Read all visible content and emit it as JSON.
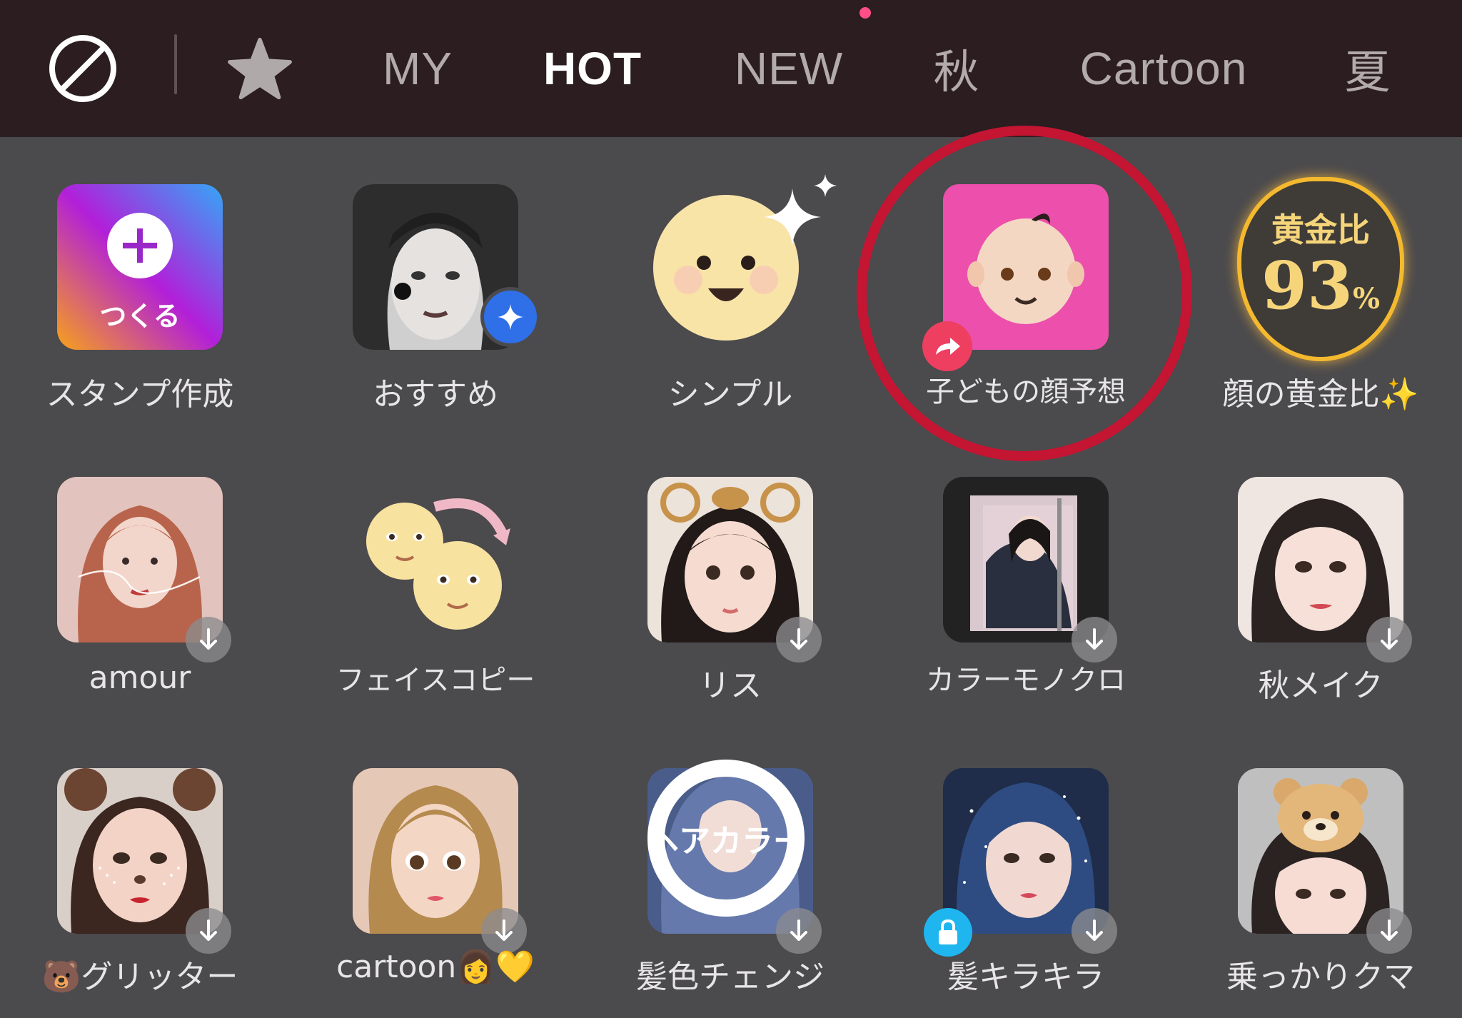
{
  "tabs": [
    {
      "label": "MY",
      "active": false
    },
    {
      "label": "HOT",
      "active": true
    },
    {
      "label": "NEW",
      "active": false
    },
    {
      "label": "秋",
      "active": false
    },
    {
      "label": "Cartoon",
      "active": false
    },
    {
      "label": "夏",
      "active": false
    }
  ],
  "icons": {
    "none": "no-filter-icon",
    "favorite": "star-icon",
    "download": "download-icon",
    "share": "share-arrow-icon",
    "lock": "lock-icon",
    "sparkle": "sparkle-icon"
  },
  "colors": {
    "topbar_bg": "#2b1d20",
    "grid_bg": "#4b4a4d",
    "highlight_circle": "#c41533",
    "tab_active": "#ffffff",
    "tab_inactive": "#b2aaab",
    "notification_dot": "#ff4f89"
  },
  "create_tile_text": "つくる",
  "golden_ratio_tile": {
    "title": "黄金比",
    "value": "93",
    "unit": "%"
  },
  "hair_color_overlay_text": "ヘアカラー",
  "stickers": [
    {
      "label": "スタンプ作成",
      "downloadable": false
    },
    {
      "label": "おすすめ",
      "downloadable": false
    },
    {
      "label": "シンプル",
      "downloadable": false
    },
    {
      "label": "子どもの顔予想",
      "downloadable": false,
      "highlighted": true
    },
    {
      "label": "顔の黄金比✨",
      "downloadable": false
    },
    {
      "label": "amour",
      "downloadable": true
    },
    {
      "label": "フェイスコピー",
      "downloadable": false
    },
    {
      "label": "リス",
      "downloadable": true
    },
    {
      "label": "カラーモノクロ",
      "downloadable": true
    },
    {
      "label": "秋メイク",
      "downloadable": true
    },
    {
      "label": "🐻グリッター",
      "downloadable": true
    },
    {
      "label": "cartoon👩💛",
      "downloadable": true
    },
    {
      "label": "髪色チェンジ",
      "downloadable": true
    },
    {
      "label": "髪キラキラ",
      "downloadable": true,
      "locked": true
    },
    {
      "label": "乗っかりクマ",
      "downloadable": true
    }
  ]
}
